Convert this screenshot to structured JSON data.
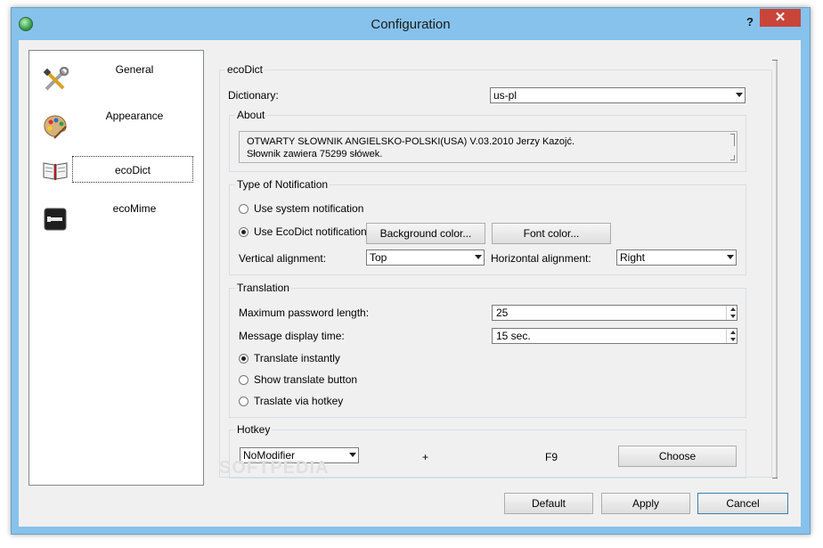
{
  "window": {
    "title": "Configuration",
    "help": "?",
    "close": "✕"
  },
  "sidebar": {
    "items": [
      {
        "label": "General",
        "icon": "tools-icon"
      },
      {
        "label": "Appearance",
        "icon": "palette-icon"
      },
      {
        "label": "ecoDict",
        "icon": "book-icon",
        "selected": true
      },
      {
        "label": "ecoMime",
        "icon": "usb-drive-icon"
      }
    ]
  },
  "ecodict": {
    "group_title": "ecoDict",
    "dictionary_label": "Dictionary:",
    "dictionary_value": "us-pl",
    "about": {
      "title": "About",
      "line1": "OTWARTY SŁOWNIK ANGIELSKO-POLSKI(USA) V.03.2010 Jerzy Kazojć.",
      "line2": "Słownik zawiera 75299 słówek."
    },
    "notification": {
      "title": "Type of Notification",
      "system_label": "Use system notification",
      "ecodict_label": "Use EcoDict notification",
      "selected": "ecodict",
      "bg_color_button": "Background color...",
      "font_color_button": "Font color...",
      "vertical_label": "Vertical alignment:",
      "vertical_value": "Top",
      "horizontal_label": "Horizontal alignment:",
      "horizontal_value": "Right"
    },
    "translation": {
      "title": "Translation",
      "max_pw_label": "Maximum password length:",
      "max_pw_value": "25",
      "msg_time_label": "Message display time:",
      "msg_time_value": "15 sec.",
      "instant_label": "Translate instantly",
      "show_button_label": "Show translate button",
      "hotkey_label": "Traslate via hotkey",
      "selected": "instant"
    },
    "hotkey": {
      "title": "Hotkey",
      "modifier_value": "NoModifier",
      "plus": "+",
      "key": "F9",
      "choose_button": "Choose"
    }
  },
  "footer": {
    "default_button": "Default",
    "apply_button": "Apply",
    "cancel_button": "Cancel"
  },
  "watermark": "SOFTPEDIA",
  "colors": {
    "frame": "#86c2ec",
    "close": "#c9453a",
    "dialog_bg": "#f0f0f0"
  }
}
